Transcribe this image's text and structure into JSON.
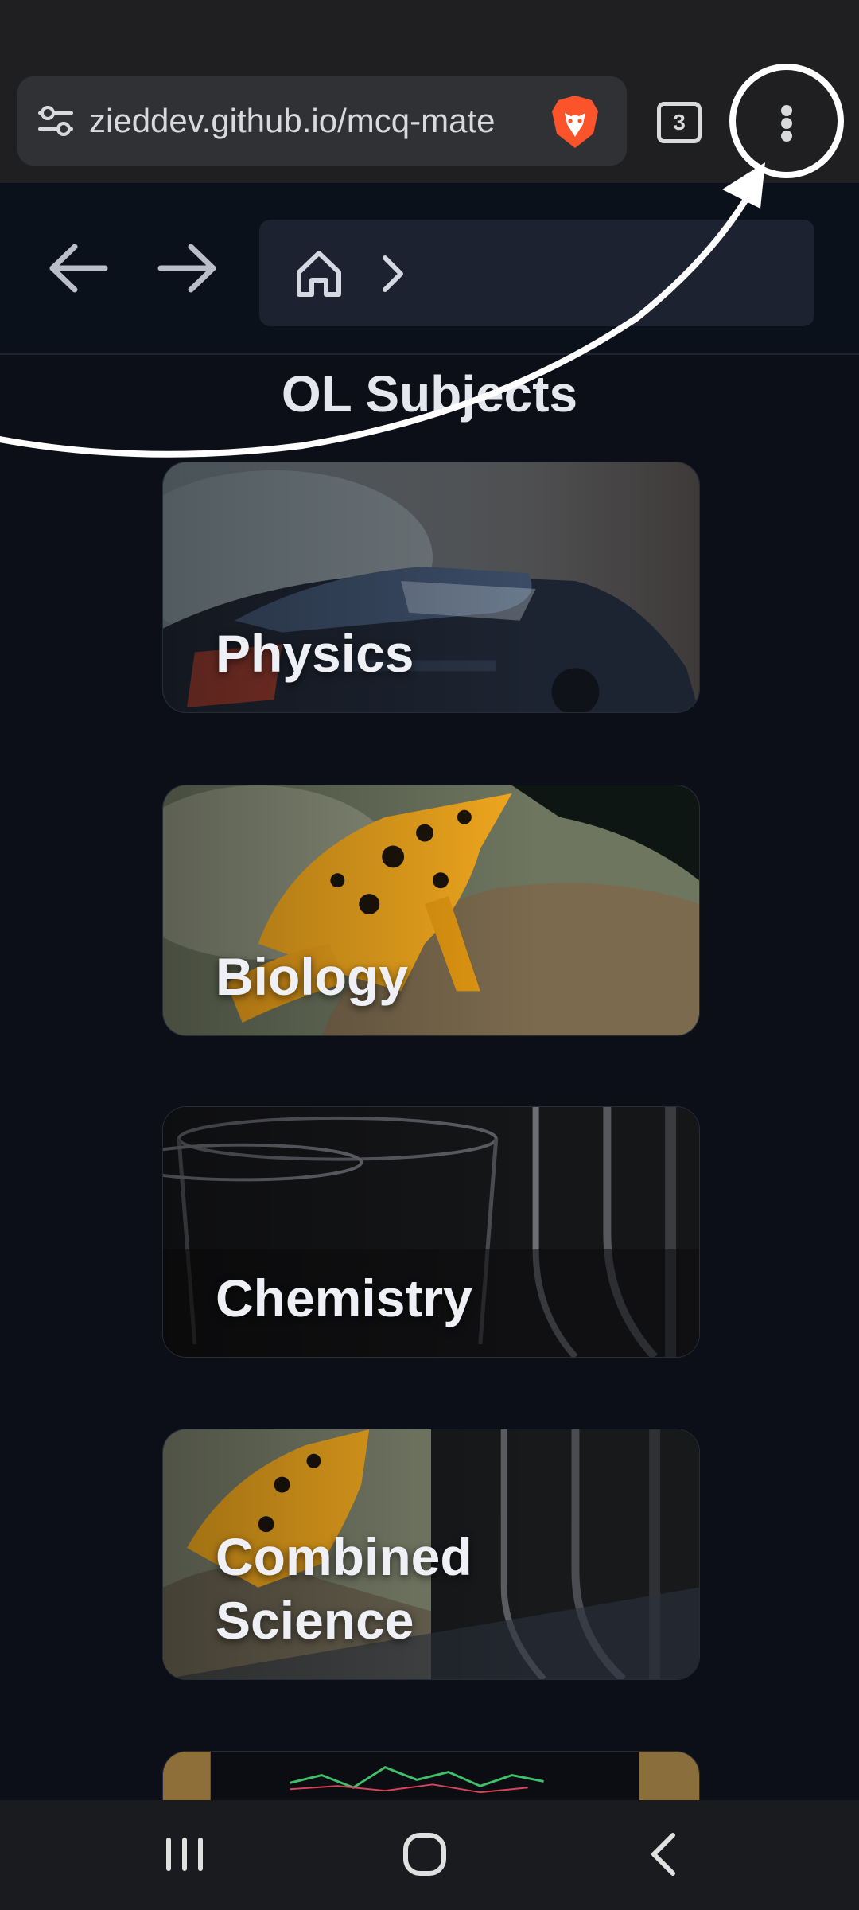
{
  "browser": {
    "url": "zieddev.github.io/mcq-mate",
    "tab_count": "3",
    "icons": {
      "site_info": "tune-icon",
      "brave": "brave-lion-icon",
      "menu": "more-vert-icon"
    }
  },
  "site_nav": {
    "icons": [
      "arrow-left-icon",
      "arrow-right-icon",
      "home-icon",
      "chevron-right-icon"
    ]
  },
  "page": {
    "title": "OL Subjects"
  },
  "subjects": [
    {
      "label": "Physics"
    },
    {
      "label": "Biology"
    },
    {
      "label": "Chemistry"
    },
    {
      "label": "Combined Science"
    }
  ],
  "colors": {
    "page_bg": "#0c0f17",
    "nav_bg": "#0b111b",
    "breadcrumb_bg": "#1c2230",
    "browser_bar": "#1f1f21",
    "annotation": "#ffffff"
  },
  "system_nav": {
    "icons": [
      "recent-apps-icon",
      "home-circle-icon",
      "back-icon"
    ]
  }
}
